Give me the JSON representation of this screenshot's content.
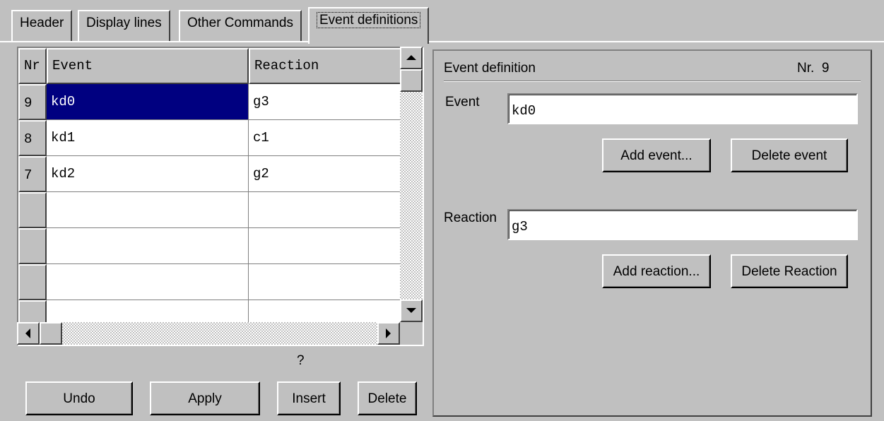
{
  "tabs": [
    {
      "label": "Header",
      "active": false
    },
    {
      "label": "Display lines",
      "active": false
    },
    {
      "label": "Other Commands",
      "active": false
    },
    {
      "label": "Event definitions",
      "active": true
    }
  ],
  "grid": {
    "headers": {
      "nr": "Nr",
      "event": "Event",
      "reaction": "Reaction"
    },
    "rows": [
      {
        "nr": "9",
        "event": "kd0",
        "reaction": "g3",
        "selected": true
      },
      {
        "nr": "8",
        "event": "kd1",
        "reaction": "c1",
        "selected": false
      },
      {
        "nr": "7",
        "event": "kd2",
        "reaction": "g2",
        "selected": false
      },
      {
        "nr": "",
        "event": "",
        "reaction": ""
      },
      {
        "nr": "",
        "event": "",
        "reaction": ""
      },
      {
        "nr": "",
        "event": "",
        "reaction": ""
      },
      {
        "nr": "",
        "event": "",
        "reaction": ""
      }
    ]
  },
  "status_text": "?",
  "buttons": {
    "undo": "Undo",
    "apply": "Apply",
    "insert": "Insert",
    "delete": "Delete"
  },
  "event_definition": {
    "title": "Event definition",
    "nr_label": "Nr.",
    "nr_value": "9",
    "event_label": "Event",
    "event_value": "kd0",
    "add_event": "Add event...",
    "delete_event": "Delete event",
    "reaction_label": "Reaction",
    "reaction_value": "g3",
    "add_reaction": "Add reaction...",
    "delete_reaction": "Delete Reaction"
  },
  "icons": {
    "scroll_up": "arrow-up-icon",
    "scroll_down": "arrow-down-icon",
    "scroll_left": "arrow-left-icon",
    "scroll_right": "arrow-right-icon"
  },
  "colors": {
    "face": "#c0c0c0",
    "selection": "#000080",
    "window": "#ffffff"
  }
}
